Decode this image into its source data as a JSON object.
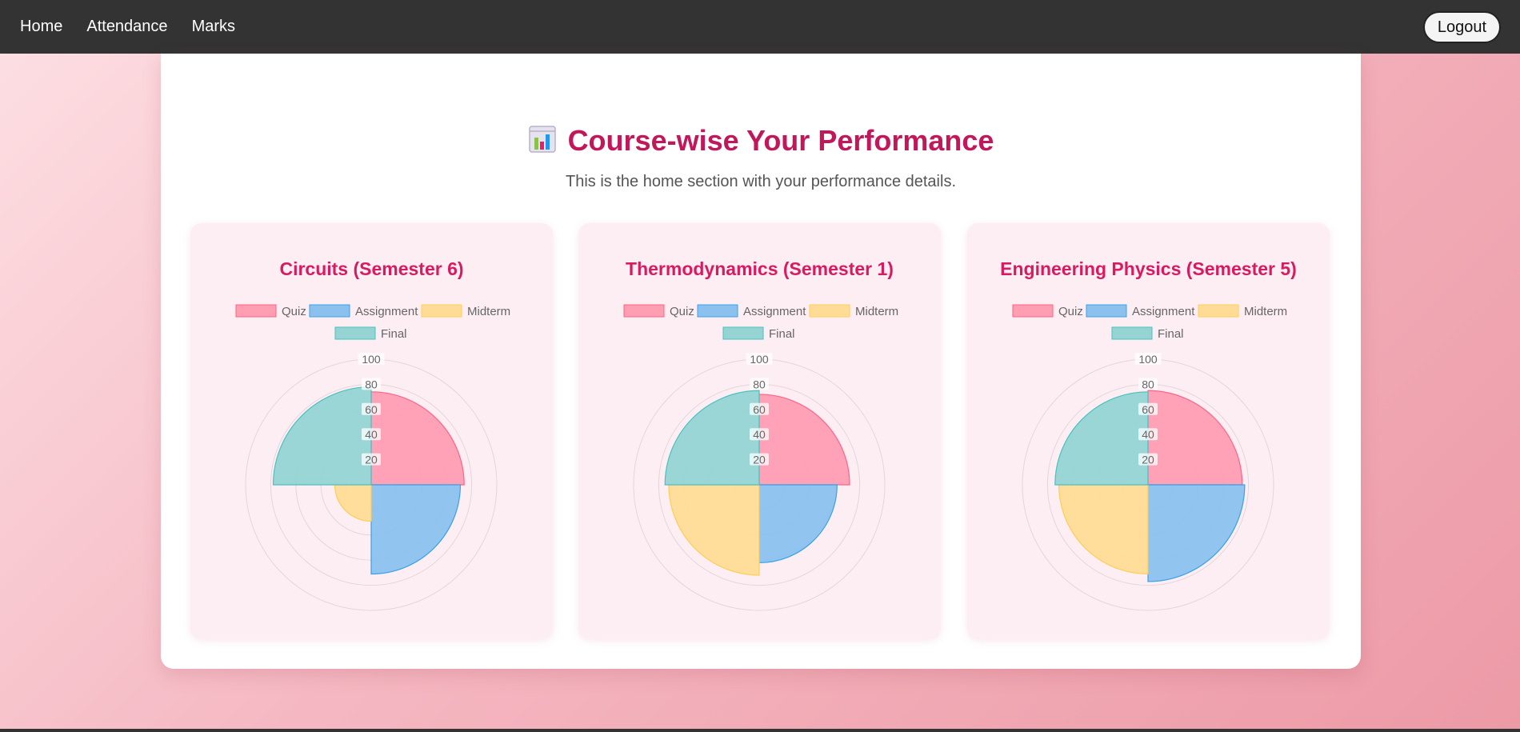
{
  "nav": {
    "items": [
      "Home",
      "Attendance",
      "Marks"
    ],
    "logout_label": "Logout"
  },
  "page": {
    "title": "Course-wise Your Performance",
    "subtitle": "This is the home section with your performance details.",
    "title_icon": "bar-chart-emoji"
  },
  "colors": {
    "navbar": "#333333",
    "accent": "#c2185b",
    "card_bg": "#fdeef3",
    "quiz": "#ff9db3",
    "assignment": "#8cc1ef",
    "midterm": "#ffdc96",
    "final": "#96d4d4"
  },
  "chart_data": [
    {
      "type": "polarArea",
      "title": "Circuits (Semester 6)",
      "categories": [
        "Quiz",
        "Assignment",
        "Midterm",
        "Final"
      ],
      "values": [
        74,
        71,
        29,
        78
      ],
      "rlim": [
        0,
        100
      ],
      "ticks": [
        20,
        40,
        60,
        80,
        100
      ],
      "legend": "top",
      "grid": true
    },
    {
      "type": "polarArea",
      "title": "Thermodynamics (Semester 1)",
      "categories": [
        "Quiz",
        "Assignment",
        "Midterm",
        "Final"
      ],
      "values": [
        72,
        62,
        72,
        75
      ],
      "rlim": [
        0,
        100
      ],
      "ticks": [
        20,
        40,
        60,
        80,
        100
      ],
      "legend": "top",
      "grid": true
    },
    {
      "type": "polarArea",
      "title": "Engineering Physics (Semester 5)",
      "categories": [
        "Quiz",
        "Assignment",
        "Midterm",
        "Final"
      ],
      "values": [
        75,
        77,
        71,
        74
      ],
      "rlim": [
        0,
        100
      ],
      "ticks": [
        20,
        40,
        60,
        80,
        100
      ],
      "legend": "top",
      "grid": true
    }
  ]
}
